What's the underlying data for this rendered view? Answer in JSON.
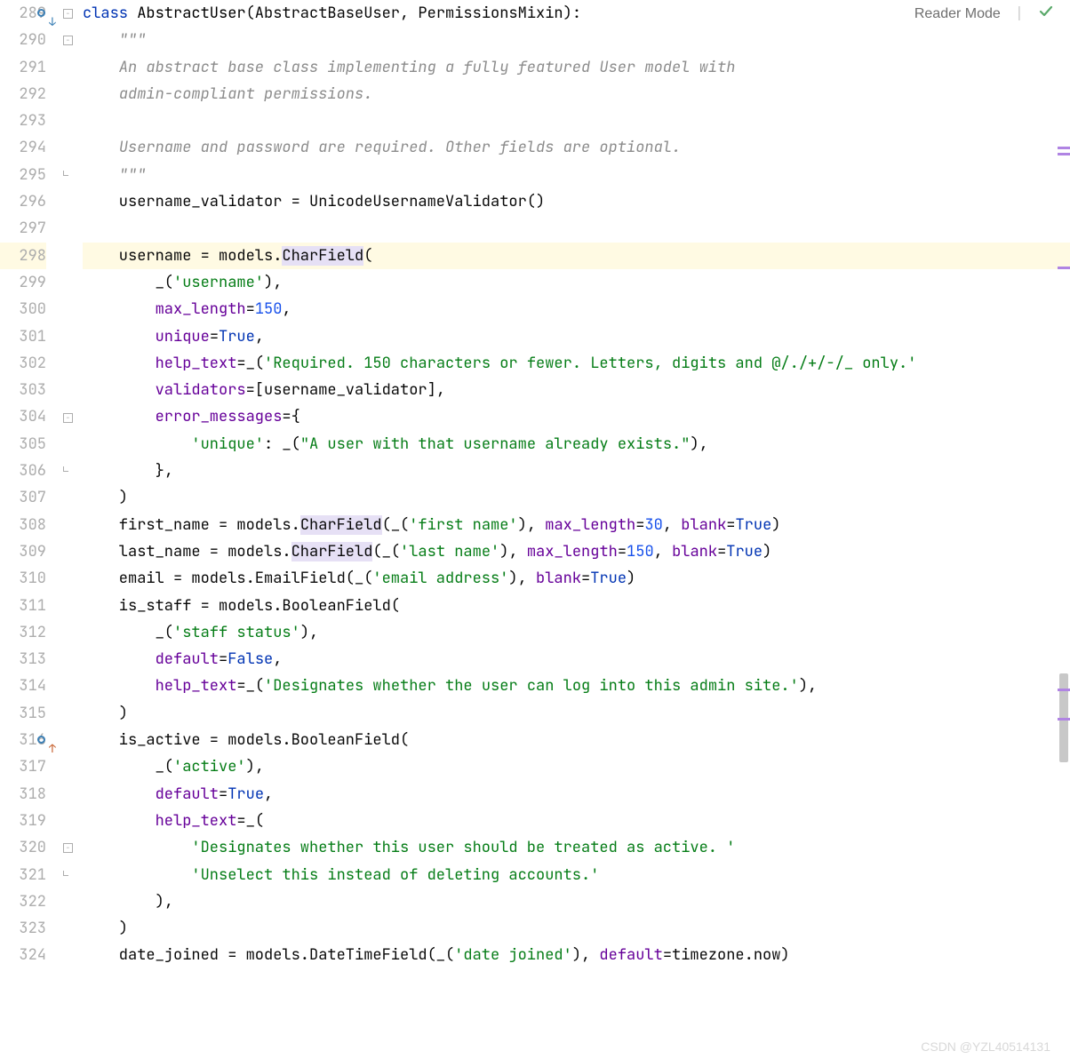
{
  "top_bar": {
    "reader_mode": "Reader Mode"
  },
  "watermark": "CSDN @YZL40514131",
  "line_start": 289,
  "highlighted_line": 298,
  "code_lines": [
    {
      "n": 289,
      "gutter": "circle-down",
      "fold": "minus",
      "segs": [
        {
          "t": "class ",
          "c": "kw"
        },
        {
          "t": "AbstractUser",
          "c": "cls"
        },
        {
          "t": "(AbstractBaseUser",
          "c": "op"
        },
        {
          "t": ",",
          "c": "op"
        },
        {
          "t": " PermissionsMixin):",
          "c": "op"
        }
      ]
    },
    {
      "n": 290,
      "fold": "minus",
      "segs": [
        {
          "t": "    ",
          "c": ""
        },
        {
          "t": "\"\"\"",
          "c": "comment"
        }
      ]
    },
    {
      "n": 291,
      "segs": [
        {
          "t": "    ",
          "c": ""
        },
        {
          "t": "An abstract base class implementing a fully featured User model with",
          "c": "comment"
        }
      ]
    },
    {
      "n": 292,
      "segs": [
        {
          "t": "    ",
          "c": ""
        },
        {
          "t": "admin-compliant permissions.",
          "c": "comment"
        }
      ]
    },
    {
      "n": 293,
      "segs": [
        {
          "t": "",
          "c": ""
        }
      ]
    },
    {
      "n": 294,
      "segs": [
        {
          "t": "    ",
          "c": ""
        },
        {
          "t": "Username and password are required. Other fields are optional.",
          "c": "comment"
        }
      ]
    },
    {
      "n": 295,
      "fold": "end",
      "segs": [
        {
          "t": "    ",
          "c": ""
        },
        {
          "t": "\"\"\"",
          "c": "comment"
        }
      ]
    },
    {
      "n": 296,
      "segs": [
        {
          "t": "    username_validator = UnicodeUsernameValidator()",
          "c": "op"
        }
      ]
    },
    {
      "n": 297,
      "segs": [
        {
          "t": "",
          "c": ""
        }
      ]
    },
    {
      "n": 298,
      "segs": [
        {
          "t": "    username = models.",
          "c": "op"
        },
        {
          "t": "CharField",
          "c": "op",
          "hl": true
        },
        {
          "t": "(",
          "c": "op"
        }
      ]
    },
    {
      "n": 299,
      "segs": [
        {
          "t": "        _(",
          "c": "op"
        },
        {
          "t": "'username'",
          "c": "str"
        },
        {
          "t": ")",
          "c": "op"
        },
        {
          "t": ",",
          "c": "op"
        }
      ]
    },
    {
      "n": 300,
      "segs": [
        {
          "t": "        ",
          "c": ""
        },
        {
          "t": "max_length",
          "c": "param"
        },
        {
          "t": "=",
          "c": "op"
        },
        {
          "t": "150",
          "c": "num"
        },
        {
          "t": ",",
          "c": "op"
        }
      ]
    },
    {
      "n": 301,
      "segs": [
        {
          "t": "        ",
          "c": ""
        },
        {
          "t": "unique",
          "c": "param"
        },
        {
          "t": "=",
          "c": "op"
        },
        {
          "t": "True",
          "c": "builtin"
        },
        {
          "t": ",",
          "c": "op"
        }
      ]
    },
    {
      "n": 302,
      "segs": [
        {
          "t": "        ",
          "c": ""
        },
        {
          "t": "help_text",
          "c": "param"
        },
        {
          "t": "=_(",
          "c": "op"
        },
        {
          "t": "'Required. 150 characters or fewer. Letters, digits and @/./+/-/_ only.'",
          "c": "str"
        }
      ]
    },
    {
      "n": 303,
      "segs": [
        {
          "t": "        ",
          "c": ""
        },
        {
          "t": "validators",
          "c": "param"
        },
        {
          "t": "=[username_validator]",
          "c": "op"
        },
        {
          "t": ",",
          "c": "op"
        }
      ]
    },
    {
      "n": 304,
      "fold": "minus",
      "segs": [
        {
          "t": "        ",
          "c": ""
        },
        {
          "t": "error_messages",
          "c": "param"
        },
        {
          "t": "={",
          "c": "op"
        }
      ]
    },
    {
      "n": 305,
      "segs": [
        {
          "t": "            ",
          "c": ""
        },
        {
          "t": "'unique'",
          "c": "str"
        },
        {
          "t": ": _(",
          "c": "op"
        },
        {
          "t": "\"A user with that username already exists.\"",
          "c": "str"
        },
        {
          "t": ")",
          "c": "op"
        },
        {
          "t": ",",
          "c": "op"
        }
      ]
    },
    {
      "n": 306,
      "fold": "end",
      "segs": [
        {
          "t": "        }",
          "c": "op"
        },
        {
          "t": ",",
          "c": "op"
        }
      ]
    },
    {
      "n": 307,
      "segs": [
        {
          "t": "    )",
          "c": "op"
        }
      ]
    },
    {
      "n": 308,
      "segs": [
        {
          "t": "    first_name = models.",
          "c": "op"
        },
        {
          "t": "CharField",
          "c": "op",
          "hl": true
        },
        {
          "t": "(_(",
          "c": "op"
        },
        {
          "t": "'first name'",
          "c": "str"
        },
        {
          "t": ")",
          "c": "op"
        },
        {
          "t": ",",
          "c": "op"
        },
        {
          "t": " ",
          "c": ""
        },
        {
          "t": "max_length",
          "c": "param"
        },
        {
          "t": "=",
          "c": "op"
        },
        {
          "t": "30",
          "c": "num"
        },
        {
          "t": ",",
          "c": "op"
        },
        {
          "t": " ",
          "c": ""
        },
        {
          "t": "blank",
          "c": "param"
        },
        {
          "t": "=",
          "c": "op"
        },
        {
          "t": "True",
          "c": "builtin"
        },
        {
          "t": ")",
          "c": "op"
        }
      ]
    },
    {
      "n": 309,
      "segs": [
        {
          "t": "    last_name = models.",
          "c": "op"
        },
        {
          "t": "CharField",
          "c": "op",
          "hl": true
        },
        {
          "t": "(_(",
          "c": "op"
        },
        {
          "t": "'last name'",
          "c": "str"
        },
        {
          "t": ")",
          "c": "op"
        },
        {
          "t": ",",
          "c": "op"
        },
        {
          "t": " ",
          "c": ""
        },
        {
          "t": "max_length",
          "c": "param"
        },
        {
          "t": "=",
          "c": "op"
        },
        {
          "t": "150",
          "c": "num"
        },
        {
          "t": ",",
          "c": "op"
        },
        {
          "t": " ",
          "c": ""
        },
        {
          "t": "blank",
          "c": "param"
        },
        {
          "t": "=",
          "c": "op"
        },
        {
          "t": "True",
          "c": "builtin"
        },
        {
          "t": ")",
          "c": "op"
        }
      ]
    },
    {
      "n": 310,
      "segs": [
        {
          "t": "    email = models.EmailField(_(",
          "c": "op"
        },
        {
          "t": "'email address'",
          "c": "str"
        },
        {
          "t": ")",
          "c": "op"
        },
        {
          "t": ",",
          "c": "op"
        },
        {
          "t": " ",
          "c": ""
        },
        {
          "t": "blank",
          "c": "param"
        },
        {
          "t": "=",
          "c": "op"
        },
        {
          "t": "True",
          "c": "builtin"
        },
        {
          "t": ")",
          "c": "op"
        }
      ]
    },
    {
      "n": 311,
      "segs": [
        {
          "t": "    is_staff = models.BooleanField(",
          "c": "op"
        }
      ]
    },
    {
      "n": 312,
      "segs": [
        {
          "t": "        _(",
          "c": "op"
        },
        {
          "t": "'staff status'",
          "c": "str"
        },
        {
          "t": ")",
          "c": "op"
        },
        {
          "t": ",",
          "c": "op"
        }
      ]
    },
    {
      "n": 313,
      "segs": [
        {
          "t": "        ",
          "c": ""
        },
        {
          "t": "default",
          "c": "param"
        },
        {
          "t": "=",
          "c": "op"
        },
        {
          "t": "False",
          "c": "builtin"
        },
        {
          "t": ",",
          "c": "op"
        }
      ]
    },
    {
      "n": 314,
      "segs": [
        {
          "t": "        ",
          "c": ""
        },
        {
          "t": "help_text",
          "c": "param"
        },
        {
          "t": "=_(",
          "c": "op"
        },
        {
          "t": "'Designates whether the user can log into this admin site.'",
          "c": "str"
        },
        {
          "t": ")",
          "c": "op"
        },
        {
          "t": ",",
          "c": "op"
        }
      ]
    },
    {
      "n": 315,
      "segs": [
        {
          "t": "    )",
          "c": "op"
        }
      ]
    },
    {
      "n": 316,
      "gutter": "circle-up",
      "segs": [
        {
          "t": "    is_active = models.BooleanField(",
          "c": "op"
        }
      ]
    },
    {
      "n": 317,
      "segs": [
        {
          "t": "        _(",
          "c": "op"
        },
        {
          "t": "'active'",
          "c": "str"
        },
        {
          "t": ")",
          "c": "op"
        },
        {
          "t": ",",
          "c": "op"
        }
      ]
    },
    {
      "n": 318,
      "segs": [
        {
          "t": "        ",
          "c": ""
        },
        {
          "t": "default",
          "c": "param"
        },
        {
          "t": "=",
          "c": "op"
        },
        {
          "t": "True",
          "c": "builtin"
        },
        {
          "t": ",",
          "c": "op"
        }
      ]
    },
    {
      "n": 319,
      "segs": [
        {
          "t": "        ",
          "c": ""
        },
        {
          "t": "help_text",
          "c": "param"
        },
        {
          "t": "=_(",
          "c": "op"
        }
      ]
    },
    {
      "n": 320,
      "fold": "minus",
      "segs": [
        {
          "t": "            ",
          "c": ""
        },
        {
          "t": "'Designates whether this user should be treated as active. '",
          "c": "str"
        }
      ]
    },
    {
      "n": 321,
      "fold": "end",
      "segs": [
        {
          "t": "            ",
          "c": ""
        },
        {
          "t": "'Unselect this instead of deleting accounts.'",
          "c": "str"
        }
      ]
    },
    {
      "n": 322,
      "segs": [
        {
          "t": "        )",
          "c": "op"
        },
        {
          "t": ",",
          "c": "op"
        }
      ]
    },
    {
      "n": 323,
      "segs": [
        {
          "t": "    )",
          "c": "op"
        }
      ]
    },
    {
      "n": 324,
      "segs": [
        {
          "t": "    date_joined = models.DateTimeField(_(",
          "c": "op"
        },
        {
          "t": "'date joined'",
          "c": "str"
        },
        {
          "t": ")",
          "c": "op"
        },
        {
          "t": ",",
          "c": "op"
        },
        {
          "t": " ",
          "c": ""
        },
        {
          "t": "default",
          "c": "param"
        },
        {
          "t": "=timezone.now)",
          "c": "op"
        }
      ]
    }
  ]
}
